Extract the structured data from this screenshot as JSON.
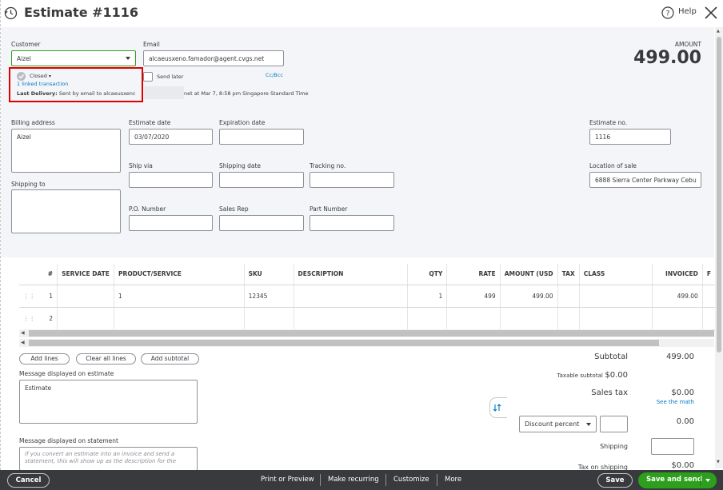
{
  "header": {
    "title": "Estimate #1116",
    "help_label": "Help"
  },
  "customer": {
    "label": "Customer",
    "value": "Aizel"
  },
  "email": {
    "label": "Email",
    "value": "alcaeusxeno.famador@agent.cvgs.net",
    "send_later": "Send later",
    "cc_bcc": "Cc/Bcc"
  },
  "status": {
    "label": "Closed",
    "linked": "1 linked transaction",
    "last_delivery_label": "Last Delivery:",
    "last_delivery_text": "Sent by email to alcaeusxenc",
    "last_delivery_rest": "net at Mar 7, 8:58 pm Singapore Standard Time"
  },
  "amount": {
    "label": "AMOUNT",
    "value": "499.00"
  },
  "form": {
    "billing_label": "Billing address",
    "billing_value": "Aizel",
    "shipping_to_label": "Shipping to",
    "estimate_date_label": "Estimate date",
    "estimate_date_value": "03/07/2020",
    "expiration_label": "Expiration date",
    "ship_via_label": "Ship via",
    "shipping_date_label": "Shipping date",
    "tracking_label": "Tracking no.",
    "po_label": "P.O. Number",
    "sales_rep_label": "Sales Rep",
    "part_label": "Part Number",
    "estimate_no_label": "Estimate no.",
    "estimate_no_value": "1116",
    "location_label": "Location of sale",
    "location_value": "6888 Sierra Center Parkway Cebu"
  },
  "table": {
    "headers": [
      "#",
      "SERVICE DATE",
      "PRODUCT/SERVICE",
      "SKU",
      "DESCRIPTION",
      "QTY",
      "RATE",
      "AMOUNT (USD",
      "TAX",
      "CLASS",
      "INVOICED",
      "F"
    ],
    "rows": [
      {
        "num": "1",
        "date": "",
        "product": "1",
        "sku": "12345",
        "desc": "",
        "qty": "1",
        "rate": "499",
        "amount": "499.00",
        "tax": "",
        "class": "",
        "invoiced": "499.00"
      },
      {
        "num": "2",
        "date": "",
        "product": "",
        "sku": "",
        "desc": "",
        "qty": "",
        "rate": "",
        "amount": "",
        "tax": "",
        "class": "",
        "invoiced": ""
      }
    ]
  },
  "buttons": {
    "add_lines": "Add lines",
    "clear_all": "Clear all lines",
    "add_subtotal": "Add subtotal"
  },
  "messages": {
    "estimate_label": "Message displayed on estimate",
    "estimate_value": "Estimate",
    "statement_label": "Message displayed on statement",
    "statement_placeholder": "If you convert an estimate into an invoice and send a statement, this will show up as the description for the"
  },
  "totals": {
    "subtotal_label": "Subtotal",
    "subtotal_value": "499.00",
    "taxable_label": "Taxable subtotal",
    "taxable_value": "$0.00",
    "sales_tax_label": "Sales tax",
    "sales_tax_value": "$0.00",
    "see_math": "See the math",
    "discount_type": "Discount percent",
    "discount_value": "0.00",
    "shipping_label": "Shipping",
    "tax_shipping_label": "Tax on shipping",
    "tax_shipping_value": "$0.00"
  },
  "footer": {
    "cancel": "Cancel",
    "print": "Print or Preview",
    "recurring": "Make recurring",
    "customize": "Customize",
    "more": "More",
    "save": "Save",
    "save_send": "Save and send"
  },
  "colors": {
    "accent_green": "#2ca01c",
    "link_blue": "#0077c5",
    "highlight_red": "#e00000",
    "footer_bg": "#393a3d"
  }
}
